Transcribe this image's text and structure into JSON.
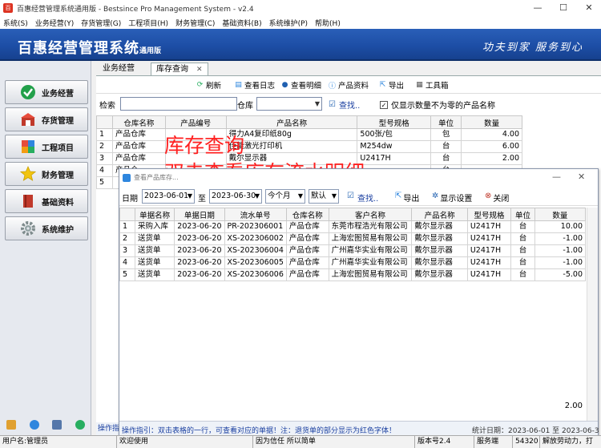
{
  "window": {
    "title": "百惠经营管理系统通用版 - Bestsince Pro Management System - v2.4",
    "controls": [
      "—",
      "☐",
      "✕"
    ]
  },
  "menu": [
    "系统(S)",
    "业务经营(Y)",
    "存货管理(G)",
    "工程项目(H)",
    "财务管理(C)",
    "基础资料(B)",
    "系统维护(P)",
    "帮助(H)"
  ],
  "banner": {
    "brand": "百惠经营管理系统",
    "edition": "通用版",
    "slogan": "功夫到家 服务到心"
  },
  "sidebar": [
    {
      "label": "业务经营",
      "icon": "check-icon",
      "color": "#22a04a"
    },
    {
      "label": "存货管理",
      "icon": "inventory-icon",
      "color": "#c0392b"
    },
    {
      "label": "工程项目",
      "icon": "project-icon",
      "color": "#d35400"
    },
    {
      "label": "财务管理",
      "icon": "star-icon",
      "color": "#f1c40f"
    },
    {
      "label": "基础资料",
      "icon": "book-icon",
      "color": "#c0392b"
    },
    {
      "label": "系统维护",
      "icon": "gear-icon",
      "color": "#7f8c8d"
    }
  ],
  "tabs": [
    {
      "label": "业务经营"
    },
    {
      "label": "库存查询"
    }
  ],
  "toolbar": {
    "refresh": "刷新",
    "view_log": "查看日志",
    "view_detail": "查看明细",
    "product_info": "产品资料",
    "export": "导出",
    "tools": "工具箱"
  },
  "search": {
    "label": "检索",
    "warehouse_label": "仓库",
    "find": "查找..",
    "checkbox_label": "仅显示数量不为零的产品名称",
    "checked": true
  },
  "inventory": {
    "headers": [
      "仓库名称",
      "产品编号",
      "产品名称",
      "型号规格",
      "单位",
      "数量"
    ],
    "rows": [
      [
        "1",
        "产品仓库",
        "",
        "得力A4复印纸80g",
        "500张/包",
        "包",
        "4.00"
      ],
      [
        "2",
        "产品仓库",
        "",
        "佳能激光打印机",
        "M254dw",
        "台",
        "6.00"
      ],
      [
        "3",
        "产品仓库",
        "",
        "戴尔显示器",
        "U2417H",
        "台",
        "2.00"
      ],
      [
        "4",
        "产品仓",
        "",
        "",
        "",
        "台",
        ""
      ],
      [
        "5",
        "",
        "",
        "",
        "",
        "",
        ""
      ]
    ]
  },
  "overlay": {
    "line1": "库存查询",
    "line2": "双击查看库存流水明细"
  },
  "dialog": {
    "title": "查看产品库存...",
    "date_label": "日期",
    "date_from": "2023-06-01",
    "to_label": "至",
    "date_to": "2023-06-30",
    "period": "今个月",
    "default_opt": "默认",
    "find": "查找..",
    "export": "导出",
    "display_settings": "显示设置",
    "close": "关闭",
    "headers": [
      "单据名称",
      "单据日期",
      "流水单号",
      "仓库名称",
      "客户名称",
      "产品名称",
      "型号规格",
      "单位",
      "数量"
    ],
    "rows": [
      [
        "1",
        "采购入库",
        "2023-06-20",
        "PR-202306001",
        "产品仓库",
        "东莞市程浩光有限公司",
        "戴尔显示器",
        "U2417H",
        "台",
        "10.00"
      ],
      [
        "2",
        "送货单",
        "2023-06-20",
        "XS-202306002",
        "产品仓库",
        "上海宏图贸易有限公司",
        "戴尔显示器",
        "U2417H",
        "台",
        "-1.00"
      ],
      [
        "3",
        "送货单",
        "2023-06-20",
        "XS-202306004",
        "产品仓库",
        "广州嘉华实业有限公司",
        "戴尔显示器",
        "U2417H",
        "台",
        "-1.00"
      ],
      [
        "4",
        "送货单",
        "2023-06-20",
        "XS-202306005",
        "产品仓库",
        "广州嘉华实业有限公司",
        "戴尔显示器",
        "U2417H",
        "台",
        "-1.00"
      ],
      [
        "5",
        "送货单",
        "2023-06-20",
        "XS-202306006",
        "产品仓库",
        "上海宏图贸易有限公司",
        "戴尔显示器",
        "U2417H",
        "台",
        "-5.00"
      ]
    ],
    "total": "2.00",
    "footer_hint": "操作指引：双击表格的一行，可查看对应的单据！注：退货单的部分显示为红色字体！",
    "footer_stats": "统计日期：2023-06-01 至 2023-06-3"
  },
  "main_hint": "操作指",
  "statusbar": [
    "用户名:管理员",
    "欢迎使用",
    "因为信任 所以简单",
    "版本号2.4",
    "服务端",
    "54320",
    "解放劳动力，打"
  ]
}
